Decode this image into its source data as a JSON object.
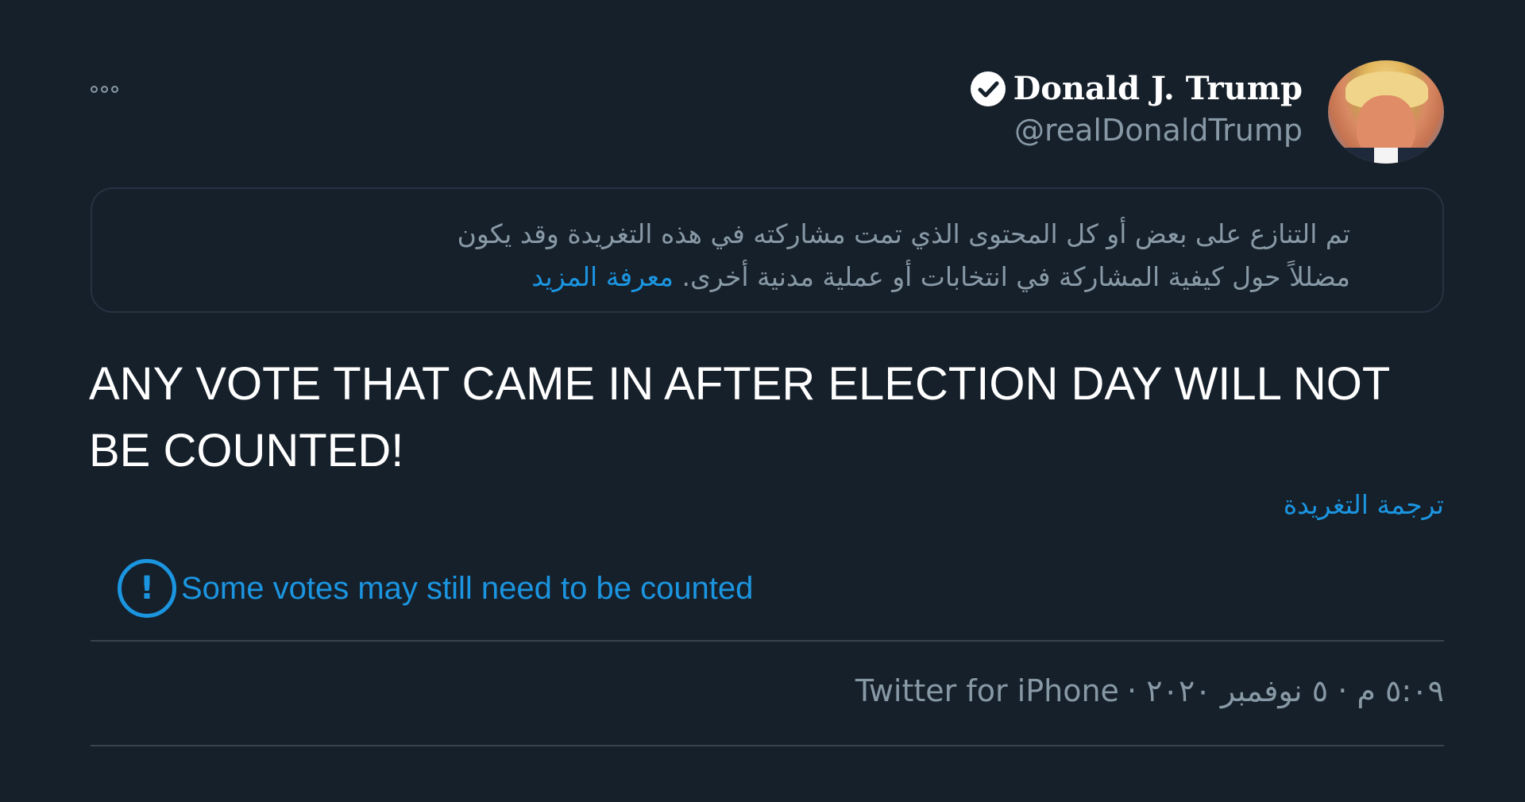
{
  "tweet": {
    "author": {
      "display_name": "Donald J. Trump",
      "handle": "@realDonaldTrump",
      "verified": true
    },
    "disputed_notice": {
      "line1": "تم التنازع على بعض أو كل المحتوى الذي تمت مشاركته في هذه التغريدة وقد يكون",
      "line2": "مضللاً حول كيفية المشاركة في انتخابات أو عملية مدنية أخرى.",
      "link_label": "معرفة المزيد"
    },
    "text": "ANY VOTE THAT CAME IN AFTER ELECTION DAY WILL NOT BE COUNTED!",
    "translate_label": "ترجمة التغريدة",
    "election_label": {
      "icon": "exclamation-circle-icon",
      "text": "Some votes may still need to be counted"
    },
    "meta": {
      "time_date": "٥:٠٩ م · ٥ نوفمبر ٢٠٢٠ ·",
      "source": "Twitter for iPhone"
    }
  },
  "colors": {
    "background": "#16202b",
    "link": "#1b95e0",
    "secondary_text": "#8899a6",
    "border": "#38444d"
  }
}
